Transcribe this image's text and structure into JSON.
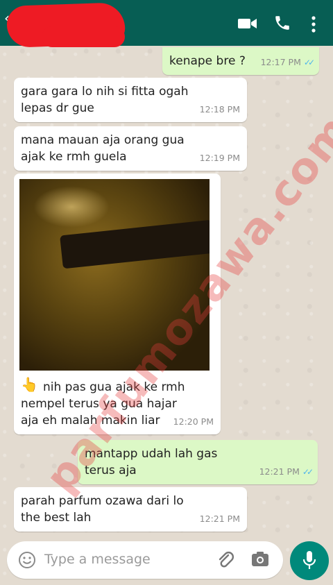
{
  "header": {
    "contact_name": "",
    "video_call_icon": "video-camera-icon",
    "voice_call_icon": "phone-icon",
    "menu_icon": "more-vertical-icon"
  },
  "messages": [
    {
      "direction": "out",
      "text": "kenape bre ?",
      "time": "12:17 PM",
      "ticks": "✓✓"
    },
    {
      "direction": "in",
      "text": "gara gara lo nih si fitta ogah\nlepas dr gue",
      "time": "12:18 PM"
    },
    {
      "direction": "in",
      "text": "mana mauan aja orang gua\najak ke rmh guela",
      "time": "12:19 PM"
    },
    {
      "direction": "in",
      "type": "image",
      "emoji": "👆",
      "text": "nih pas gua ajak ke rmh\nnempel terus ya gua hajar\naja eh malah makin liar",
      "time": "12:20 PM"
    },
    {
      "direction": "out",
      "text": "mantapp udah lah gas\nterus aja",
      "time": "12:21 PM",
      "ticks": "✓✓"
    },
    {
      "direction": "in",
      "text": "parah parfum ozawa dari lo\nthe best lah",
      "time": "12:21 PM"
    }
  ],
  "composer": {
    "placeholder": "Type a message",
    "emoji_icon": "emoji-icon",
    "attach_icon": "paperclip-icon",
    "camera_icon": "camera-icon",
    "mic_icon": "microphone-icon"
  },
  "watermark": "parfumozawa.com",
  "colors": {
    "header": "#075e54",
    "outgoing": "#dcf8c6",
    "incoming": "#ffffff",
    "mic": "#00897b",
    "ticks": "#4fb6ec"
  }
}
